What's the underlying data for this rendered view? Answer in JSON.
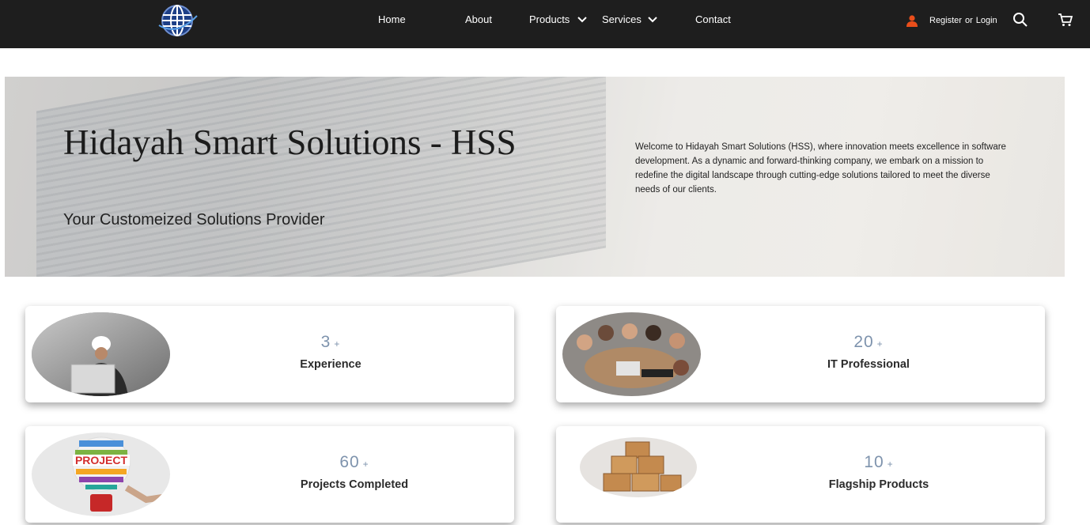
{
  "nav": {
    "items": [
      {
        "label": "Home"
      },
      {
        "label": "About"
      },
      {
        "label": "Products"
      },
      {
        "label": "Services"
      },
      {
        "label": "Contact"
      }
    ],
    "register": "Register",
    "or": "or",
    "login": "Login",
    "user_icon_color": "#e94e1b"
  },
  "hero": {
    "title": "Hidayah Smart Solutions - HSS",
    "subtitle": "Your Customeized Solutions Provider",
    "description": "Welcome to Hidayah Smart Solutions (HSS), where innovation meets excellence in software development. As a dynamic and forward-thinking company, we embark on a mission to redefine the digital landscape through cutting-edge solutions tailored to meet the diverse needs of our clients."
  },
  "stats": [
    {
      "value": "3",
      "suffix": "+",
      "label": "Experience"
    },
    {
      "value": "20",
      "suffix": "+",
      "label": "IT Professional"
    },
    {
      "value": "60",
      "suffix": "+",
      "label": "Projects Completed"
    },
    {
      "value": "10",
      "suffix": "+",
      "label": "Flagship Products"
    }
  ],
  "colors": {
    "navbar_bg": "#1e1e1e",
    "stat_number": "#7e93ad",
    "accent_orange": "#e94e1b"
  }
}
